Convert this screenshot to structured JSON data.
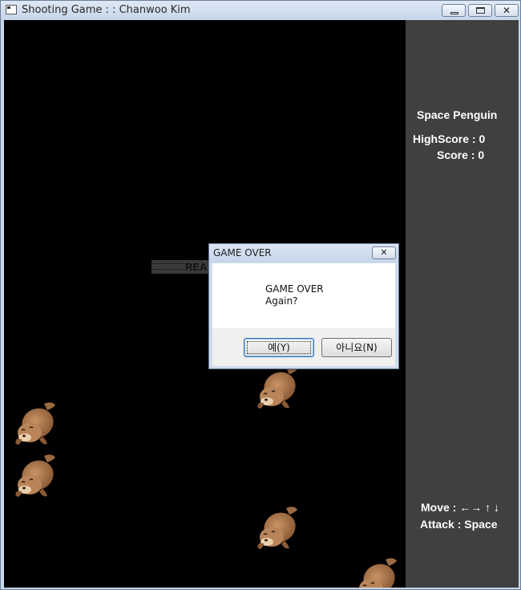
{
  "window": {
    "title": "Shooting Game : : Chanwoo Kim",
    "minimize_icon": "minimize-icon",
    "maximize_icon": "maximize-icon",
    "close_icon": "close-icon",
    "close_glyph": "✕"
  },
  "playfield": {
    "background": "#000000",
    "ready_text": "REA",
    "enemies": [
      {
        "sprite": "seal"
      },
      {
        "sprite": "seal"
      },
      {
        "sprite": "seal"
      },
      {
        "sprite": "seal"
      },
      {
        "sprite": "seal"
      }
    ]
  },
  "sidebar": {
    "background": "#404040",
    "game_title": "Space Penguin",
    "highscore_label": "HighScore : 0",
    "score_label": "Score : 0",
    "move_label": "Move : ←→ ↑ ↓",
    "attack_label": "Attack : Space"
  },
  "dialog": {
    "title": "GAME OVER",
    "close_glyph": "✕",
    "message_line1": "GAME OVER",
    "message_line2": "Again?",
    "yes_label": "예(Y)",
    "no_label": "아니요(N)"
  }
}
